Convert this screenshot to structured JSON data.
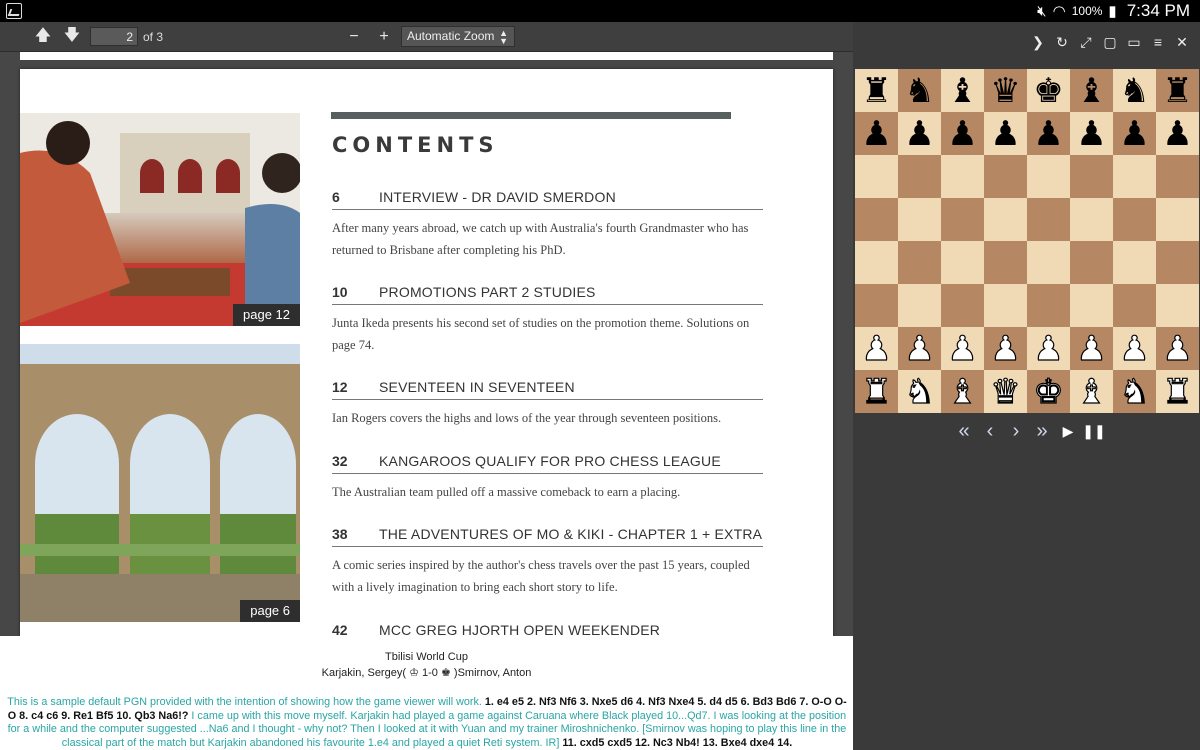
{
  "status_bar": {
    "battery": "100%",
    "time": "7:34 PM"
  },
  "pdf_toolbar": {
    "current_page": "2",
    "page_of": "of 3",
    "zoom": "Automatic Zoom"
  },
  "page": {
    "photo_tags": [
      "page 12",
      "page 6"
    ],
    "contents_title": "CONTENTS",
    "entries": [
      {
        "num": "6",
        "title": "INTERVIEW - DR DAVID SMERDON",
        "desc": "After many years abroad, we catch up with Australia's fourth Grandmaster who has returned to Brisbane after completing his PhD."
      },
      {
        "num": "10",
        "title": "PROMOTIONS PART 2  STUDIES",
        "desc": "Junta Ikeda presents his second set of studies on the promotion theme. Solutions on page 74."
      },
      {
        "num": "12",
        "title": "SEVENTEEN IN SEVENTEEN",
        "desc": "Ian Rogers covers the highs and lows of the year through seventeen positions."
      },
      {
        "num": "32",
        "title": "KANGAROOS QUALIFY FOR PRO CHESS LEAGUE",
        "desc": "The Australian team pulled off a massive comeback to earn a placing."
      },
      {
        "num": "38",
        "title": "THE ADVENTURES OF MO & KIKI - CHAPTER 1 + EXTRA",
        "desc": "A comic series inspired by the author's chess travels over the past 15 years, coupled with a lively imagination to bring each short story to life."
      },
      {
        "num": "42",
        "title": "MCC GREG HJORTH OPEN WEEKENDER",
        "desc": ""
      }
    ]
  },
  "game": {
    "event": "Tbilisi World Cup",
    "white": "Karjakin, Sergey(",
    "result": "1-0",
    "black": ")Smirnov, Anton",
    "comment1": "This is a sample default PGN provided with the intention of showing how the game viewer will work.",
    "moves1": "1. e4 e5 2. Nf3 Nf6 3. Nxe5 d6 4. Nf3 Nxe4 5. d4 d5 6. Bd3 Bd6 7. O-O O-O 8. c4 c6 9. Re1 Bf5 10. Qb3 Na6!?",
    "comment2": "I came up with this move myself. Karjakin had played a game against Caruana where Black played 10...Qd7. I was looking at the position for a while and the computer suggested ...Na6 and I thought - why not? Then I looked at it with Yuan and my trainer Miroshnichenko. [Smirnov was hoping to play this line in the classical part of the match but Karjakin abandoned his favourite 1.e4 and played a quiet Reti system. IR]",
    "moves2": "11. cxd5 cxd5 12. Nc3 Nb4! 13. Bxe4 dxe4 14."
  },
  "board": {
    "ranks": [
      [
        "♜",
        "♞",
        "♝",
        "♛",
        "♚",
        "♝",
        "♞",
        "♜"
      ],
      [
        "♟",
        "♟",
        "♟",
        "♟",
        "♟",
        "♟",
        "♟",
        "♟"
      ],
      [
        "",
        "",
        "",
        "",
        "",
        "",
        "",
        ""
      ],
      [
        "",
        "",
        "",
        "",
        "",
        "",
        "",
        ""
      ],
      [
        "",
        "",
        "",
        "",
        "",
        "",
        "",
        ""
      ],
      [
        "",
        "",
        "",
        "",
        "",
        "",
        "",
        ""
      ],
      [
        "♟",
        "♟",
        "♟",
        "♟",
        "♟",
        "♟",
        "♟",
        "♟"
      ],
      [
        "♜",
        "♞",
        "♝",
        "♛",
        "♚",
        "♝",
        "♞",
        "♜"
      ]
    ],
    "colors": {
      "light": "#f0d9b5",
      "dark": "#b58863"
    }
  }
}
